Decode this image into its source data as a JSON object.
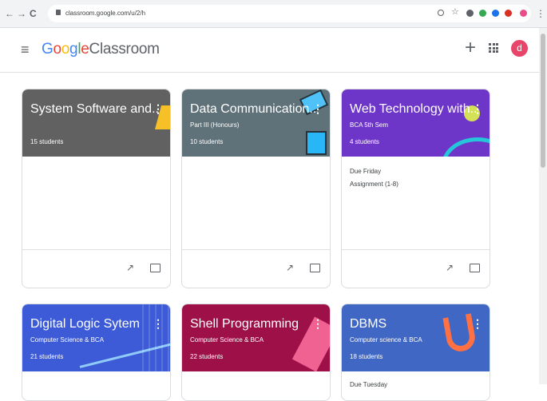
{
  "browser": {
    "url": "classroom.google.com/u/2/h",
    "back_icon": "arrow-left",
    "forward_icon": "arrow-right",
    "reload_icon": "refresh"
  },
  "header": {
    "logo_letters": [
      "G",
      "o",
      "o",
      "g",
      "l",
      "e"
    ],
    "logo_colors": [
      "#4285F4",
      "#EA4335",
      "#FBBC05",
      "#4285F4",
      "#34A853",
      "#EA4335"
    ],
    "app_name": "Classroom",
    "avatar_letter": "d",
    "avatar_color": "#e8456b"
  },
  "classes": [
    {
      "title": "System Software and...",
      "subtitle": "",
      "students": "15 students",
      "color": "#616161"
    },
    {
      "title": "Data Communication...",
      "subtitle": "Part III (Honours)",
      "students": "10 students",
      "color": "#5f7179"
    },
    {
      "title": "Web Technology with...",
      "subtitle": "BCA 5th Sem",
      "students": "4 students",
      "color": "#6e36c8",
      "due": "Due Friday",
      "assignment": "Assignment (1-8)"
    },
    {
      "title": "Digital Logic Sytem",
      "subtitle": "Computer Science & BCA",
      "students": "21 students",
      "color": "#3d5bd6"
    },
    {
      "title": "Shell Programming",
      "subtitle": "Computer Science & BCA",
      "students": "22 students",
      "color": "#9e1048"
    },
    {
      "title": "DBMS",
      "subtitle": "Computer science & BCA",
      "students": "18 students",
      "color": "#4167c4",
      "due": "Due Tuesday"
    }
  ]
}
